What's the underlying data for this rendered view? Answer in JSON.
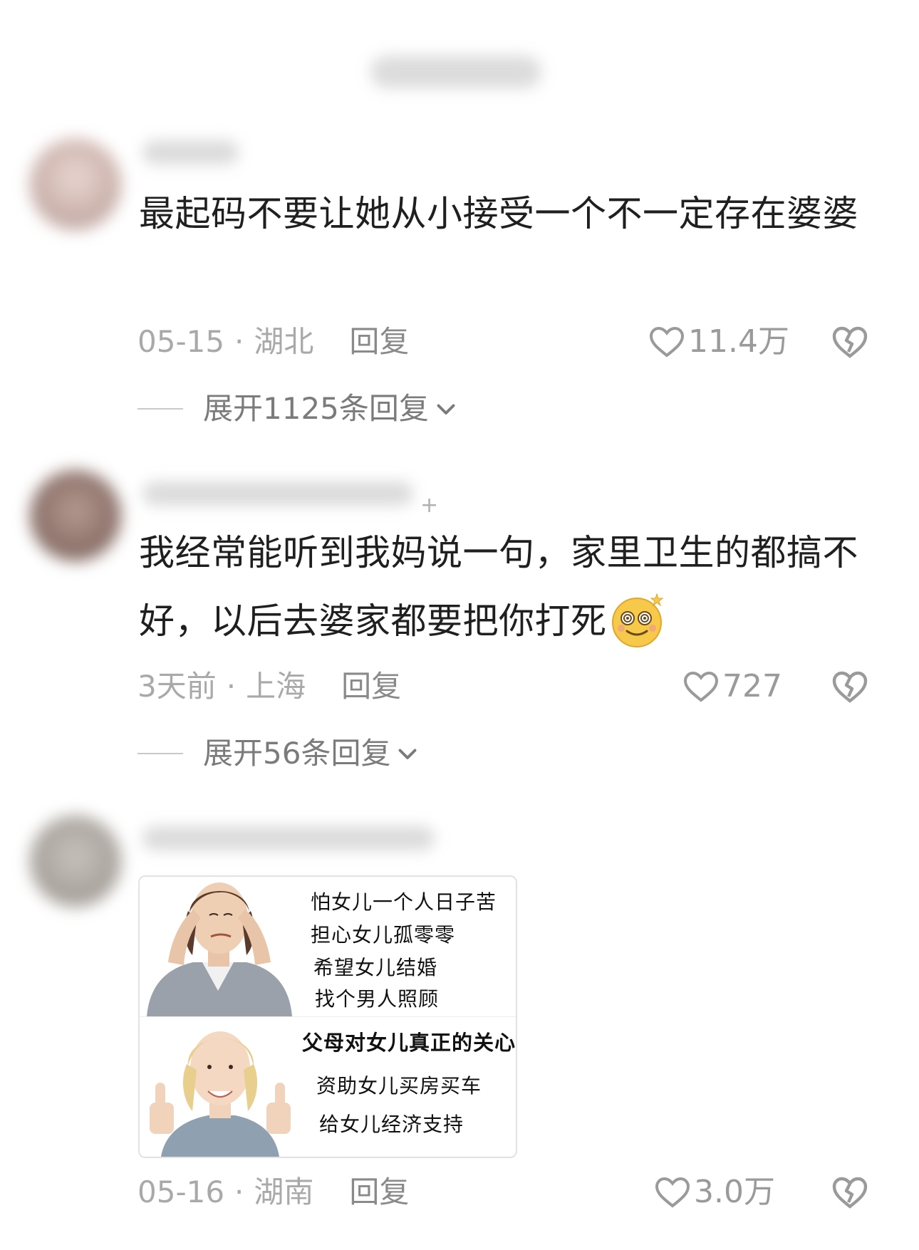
{
  "comments": [
    {
      "text": "最起码不要让她从小接受一个不一定存在婆婆",
      "date": "05-15",
      "location": "湖北",
      "reply_label": "回复",
      "likes": "11.4万",
      "expand": "展开1125条回复"
    },
    {
      "text": "我经常能听到我妈说一句，家里卫生的都搞不好，以后去婆家都要把你打死",
      "emoji": "dizzy-smiling-face-emoji",
      "date": "3天前",
      "location": "上海",
      "reply_label": "回复",
      "likes": "727",
      "expand": "展开56条回复"
    },
    {
      "image": {
        "top_lines": [
          "怕女儿一个人日子苦",
          "担心女儿孤零零",
          "希望女儿结婚",
          "找个男人照顾"
        ],
        "heading": "父母对女儿真正的关心:",
        "bottom_lines": [
          "资助女儿买房买车",
          "给女儿经济支持"
        ]
      },
      "date": "05-16",
      "location": "湖南",
      "reply_label": "回复",
      "likes": "3.0万"
    }
  ],
  "icons": {
    "like": "heart-outline-icon",
    "dislike": "broken-heart-icon",
    "expand": "chevron-down-icon"
  },
  "colors": {
    "meta": "#a9a9a9",
    "text": "#1f1f1f",
    "background": "#ffffff"
  }
}
